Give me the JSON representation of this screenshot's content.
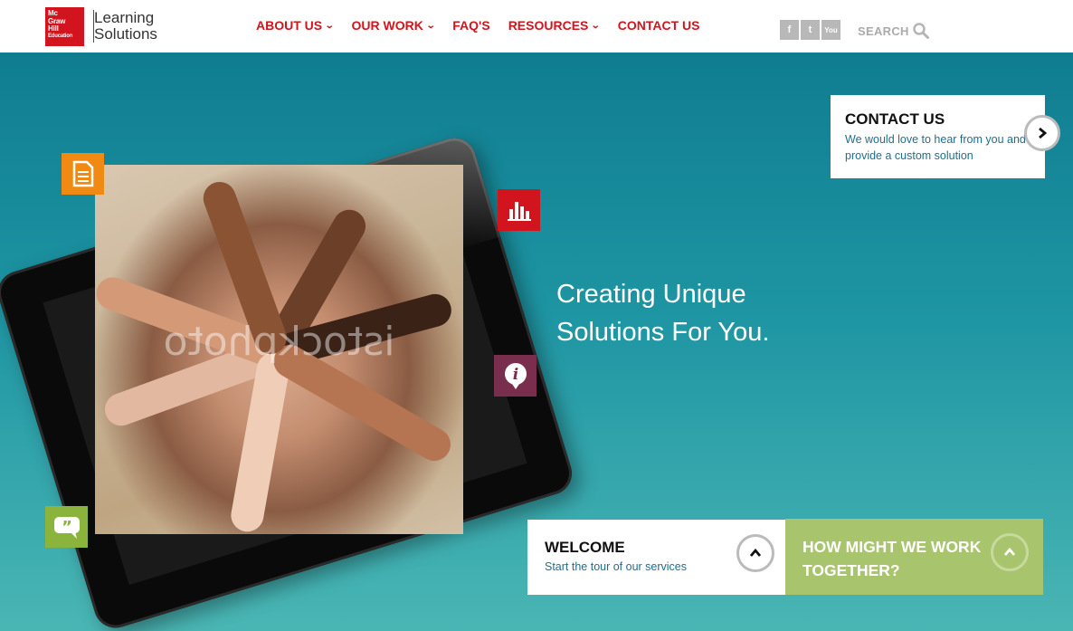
{
  "logo": {
    "mark_lines": [
      "Mc",
      "Graw",
      "Hill",
      "Education"
    ],
    "text_lines": [
      "Learning",
      "Solutions"
    ]
  },
  "nav": {
    "items": [
      {
        "label": "ABOUT US",
        "has_dropdown": true
      },
      {
        "label": "OUR WORK",
        "has_dropdown": true
      },
      {
        "label": "FAQ'S",
        "has_dropdown": false
      },
      {
        "label": "RESOURCES",
        "has_dropdown": true
      },
      {
        "label": "CONTACT US",
        "has_dropdown": false
      }
    ]
  },
  "social": {
    "facebook": "f",
    "twitter": "t",
    "youtube": "You"
  },
  "search": {
    "label": "SEARCH"
  },
  "hero": {
    "title_line1": "Creating Unique",
    "title_line2": "Solutions For You.",
    "watermark": "istockphoto"
  },
  "contact_card": {
    "title": "CONTACT US",
    "description": "We would love to hear from you and provide a custom solution"
  },
  "welcome_card": {
    "title": "WELCOME",
    "description": "Start the tour of our services"
  },
  "how_card": {
    "title": "HOW MIGHT WE WORK TOGETHER?"
  },
  "colors": {
    "brand_red": "#d2141e",
    "hero_teal": "#1e95a3",
    "accent_green": "#a8c46c",
    "link_blue": "#1f6e8c",
    "document_orange": "#f08a12",
    "quote_green": "#8ab43c",
    "info_plum": "#7a2e4e"
  }
}
